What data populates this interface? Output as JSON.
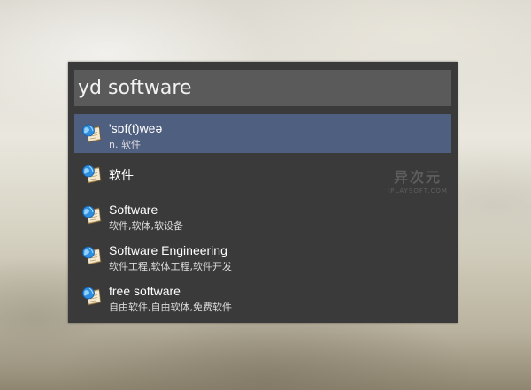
{
  "search": {
    "query": "yd software"
  },
  "watermark": {
    "main": "异次元",
    "sub": "IPLAYSOFT.COM"
  },
  "results": [
    {
      "title": "'sɒf(t)weə",
      "subtitle": "n. 软件",
      "icon": "dictionary-book-globe-icon",
      "selected": true
    },
    {
      "title": "软件",
      "subtitle": "",
      "icon": "dictionary-book-globe-icon",
      "selected": false
    },
    {
      "title": "Software",
      "subtitle": "软件,软体,软设备",
      "icon": "dictionary-book-globe-icon",
      "selected": false
    },
    {
      "title": "Software Engineering",
      "subtitle": "软件工程,软体工程,软件开发",
      "icon": "dictionary-book-globe-icon",
      "selected": false
    },
    {
      "title": "free software",
      "subtitle": "自由软件,自由软体,免费软件",
      "icon": "dictionary-book-globe-icon",
      "selected": false
    }
  ],
  "colors": {
    "panel": "#3a3a3a",
    "search_box": "#5a5a5a",
    "selected_row": "#4f5f80"
  }
}
